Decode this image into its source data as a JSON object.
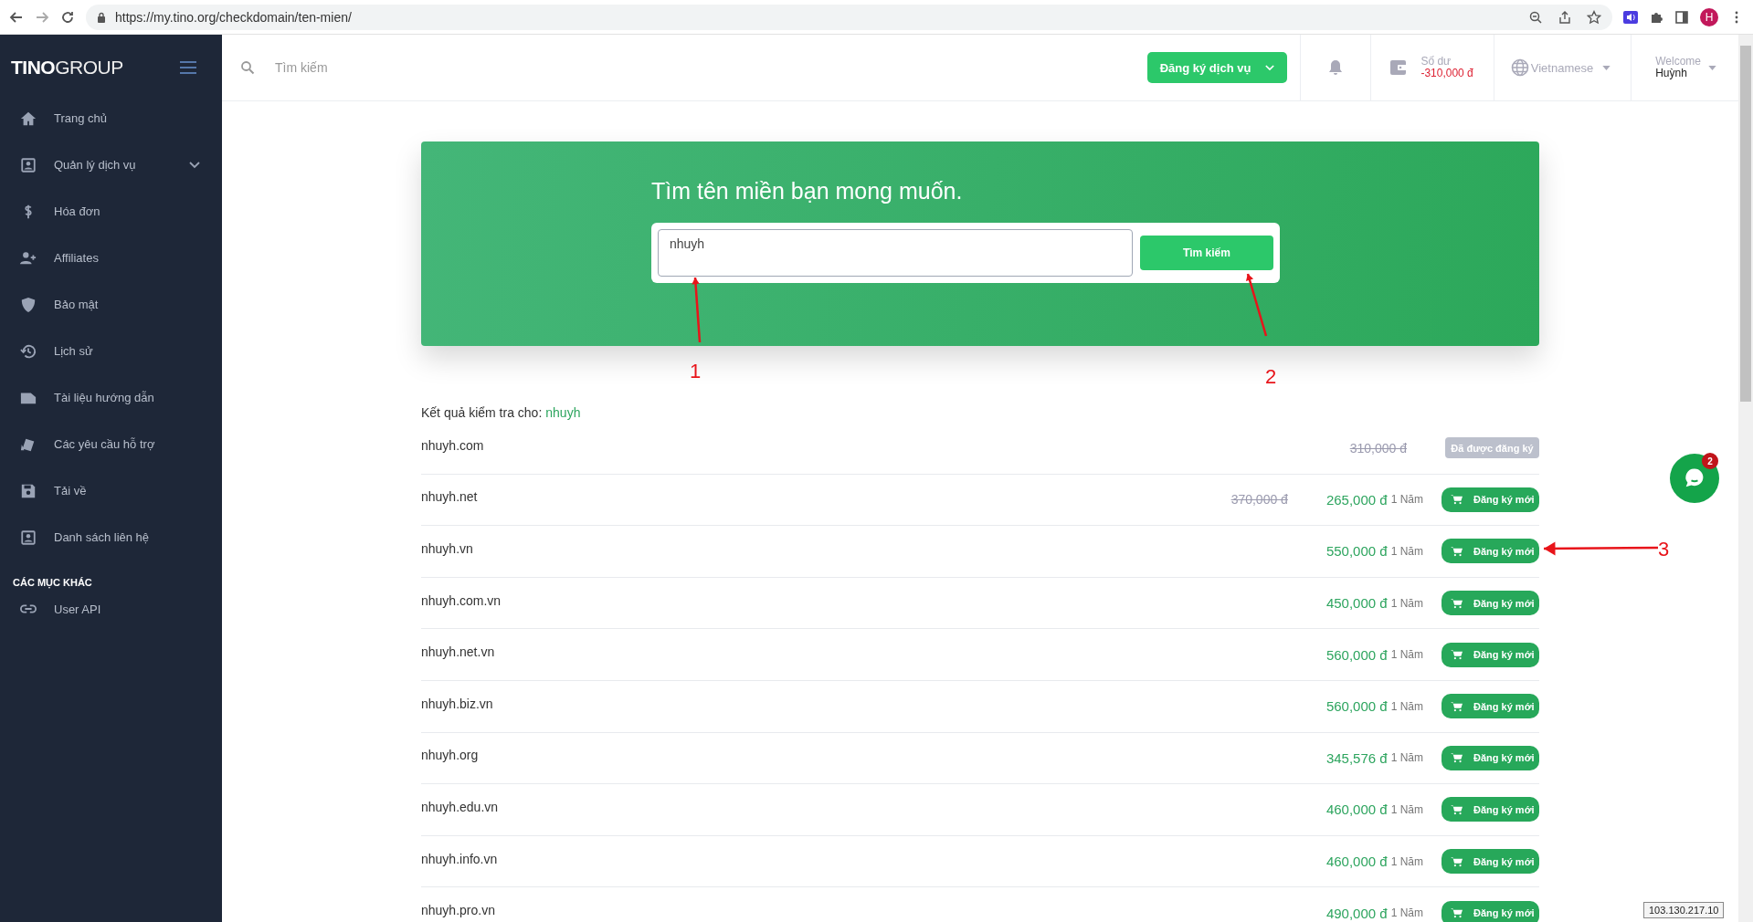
{
  "browser": {
    "url": "https://my.tino.org/checkdomain/ten-mien/",
    "profile_initial": "H"
  },
  "sidebar": {
    "logo_left": "TINO",
    "logo_right": "GROUP",
    "items": [
      {
        "label": "Trang chủ",
        "kind": "home",
        "expandable": false
      },
      {
        "label": "Quản lý dịch vụ",
        "kind": "contact",
        "expandable": true
      },
      {
        "label": "Hóa đơn",
        "kind": "dollar",
        "expandable": false
      },
      {
        "label": "Affiliates",
        "kind": "users",
        "expandable": false
      },
      {
        "label": "Bảo mật",
        "kind": "shield",
        "expandable": false
      },
      {
        "label": "Lịch sử",
        "kind": "history",
        "expandable": false
      },
      {
        "label": "Tài liệu hướng dẫn",
        "kind": "doc",
        "expandable": false
      },
      {
        "label": "Các yêu cầu hỗ trợ",
        "kind": "tickets",
        "expandable": false
      },
      {
        "label": "Tải về",
        "kind": "save",
        "expandable": false
      },
      {
        "label": "Danh sách liên hệ",
        "kind": "contact",
        "expandable": false
      }
    ],
    "section_title": "CÁC MỤC KHÁC",
    "extra_items": [
      {
        "label": "User API",
        "kind": "link",
        "expandable": false
      }
    ]
  },
  "header": {
    "search_placeholder": "Tìm kiếm",
    "service_button": "Đăng ký dịch vụ",
    "balance_label": "Số dư",
    "balance_value": "-310,000 đ",
    "language": "Vietnamese",
    "welcome": "Welcome",
    "user": "Huỳnh"
  },
  "hero": {
    "title": "Tìm tên miền bạn mong muốn.",
    "query": "nhuyh",
    "button": "Tìm kiếm"
  },
  "results": {
    "label": "Kết quả kiểm tra cho:",
    "query": "nhuyh",
    "rows": [
      {
        "domain": "nhuyh.com",
        "kind": "registered",
        "price": "310,000 đ",
        "button": "Đã được đăng ký"
      },
      {
        "domain": "nhuyh.net",
        "kind": "available",
        "old_price": "370,000 đ",
        "price": "265,000 đ",
        "period": "1 Năm",
        "button": "Đăng ký mới"
      },
      {
        "domain": "nhuyh.vn",
        "kind": "available",
        "price": "550,000 đ",
        "period": "1 Năm",
        "button": "Đăng ký mới"
      },
      {
        "domain": "nhuyh.com.vn",
        "kind": "available",
        "price": "450,000 đ",
        "period": "1 Năm",
        "button": "Đăng ký mới"
      },
      {
        "domain": "nhuyh.net.vn",
        "kind": "available",
        "price": "560,000 đ",
        "period": "1 Năm",
        "button": "Đăng ký mới"
      },
      {
        "domain": "nhuyh.biz.vn",
        "kind": "available",
        "price": "560,000 đ",
        "period": "1 Năm",
        "button": "Đăng ký mới"
      },
      {
        "domain": "nhuyh.org",
        "kind": "available",
        "price": "345,576 đ",
        "period": "1 Năm",
        "button": "Đăng ký mới"
      },
      {
        "domain": "nhuyh.edu.vn",
        "kind": "available",
        "price": "460,000 đ",
        "period": "1 Năm",
        "button": "Đăng ký mới"
      },
      {
        "domain": "nhuyh.info.vn",
        "kind": "available",
        "price": "460,000 đ",
        "period": "1 Năm",
        "button": "Đăng ký mới"
      },
      {
        "domain": "nhuyh.pro.vn",
        "kind": "available",
        "price": "490,000 đ",
        "period": "1 Năm",
        "button": "Đăng ký mới"
      }
    ]
  },
  "chat": {
    "badge": "2"
  },
  "ip_tooltip": "103.130.217.10",
  "annotations": [
    {
      "label": "1"
    },
    {
      "label": "2"
    },
    {
      "label": "3"
    }
  ]
}
